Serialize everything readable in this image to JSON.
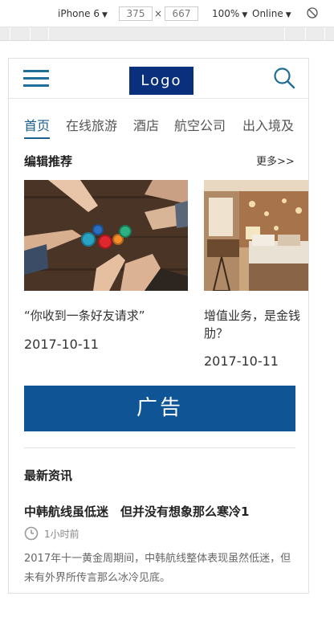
{
  "devtools": {
    "device": "iPhone 6",
    "width": "375",
    "height": "667",
    "times": "×",
    "zoom": "100%",
    "network": "Online",
    "caret": "▼"
  },
  "header": {
    "logo": "Logo"
  },
  "tabs": [
    "首页",
    "在线旅游",
    "酒店",
    "航空公司",
    "出入境及"
  ],
  "editor_picks": {
    "title": "编辑推荐",
    "more": "更多>>",
    "cards": [
      {
        "title": "“你收到一条好友请求”",
        "date": "2017-10-11"
      },
      {
        "title_line1": "增值业务，是金钱",
        "title_line2": "肋？",
        "date": "2017-10-11"
      }
    ]
  },
  "ad": {
    "label": "广告"
  },
  "news": {
    "section_title": "最新资讯",
    "item_title": "中韩航线虽低迷　但并没有想象那么寒冷1",
    "time": "1小时前",
    "body": "2017年十一黄金周期间，中韩航线整体表现虽然低迷，但未有外界所传言那么冰冷见底。"
  }
}
